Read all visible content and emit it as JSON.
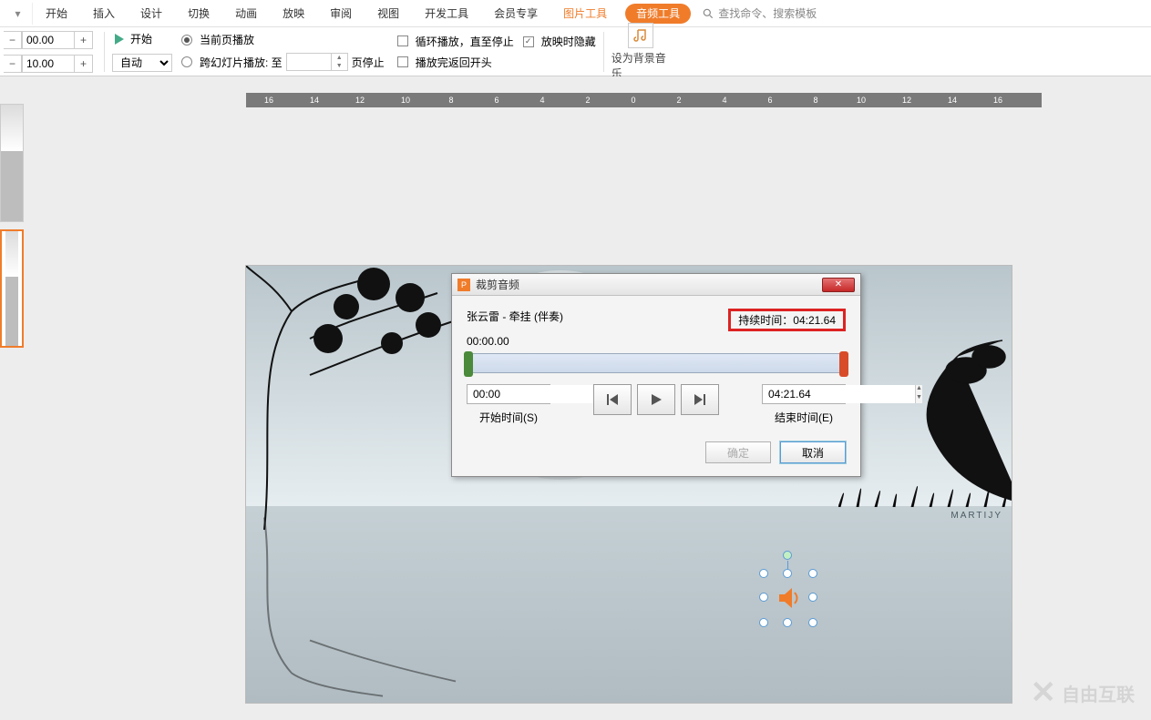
{
  "menu": {
    "tabs": [
      "开始",
      "插入",
      "设计",
      "切换",
      "动画",
      "放映",
      "审阅",
      "视图",
      "开发工具",
      "会员专享"
    ],
    "pic_tools": "图片工具",
    "audio_tools": "音频工具",
    "search_ph": "查找命令、搜索模板"
  },
  "ribbon": {
    "spin1": "00.00",
    "spin2": "10.00",
    "start_btn": "开始",
    "auto": "自动",
    "current_play": "当前页播放",
    "cross_play": "跨幻灯片播放: 至",
    "page_stop": "页停止",
    "loop_play": "循环播放，直至停止",
    "return_begin": "播放完返回开头",
    "hide_play": "放映时隐藏",
    "bg_music": "设为背景音乐"
  },
  "ruler": [
    "16",
    "14",
    "12",
    "10",
    "8",
    "6",
    "4",
    "2",
    "0",
    "2",
    "4",
    "6",
    "8",
    "10",
    "12",
    "14",
    "16"
  ],
  "dialog": {
    "title": "裁剪音频",
    "track": "张云雷 - 牵挂 (伴奏)",
    "pos": "00:00.00",
    "duration_label": "持续时间：04:21.64",
    "start_val": "00:00",
    "end_val": "04:21.64",
    "start_label": "开始时间(S)",
    "end_label": "结束时间(E)",
    "ok": "确定",
    "cancel": "取消"
  },
  "watermark": "自由互联",
  "slide_mark": "MARTIJY"
}
